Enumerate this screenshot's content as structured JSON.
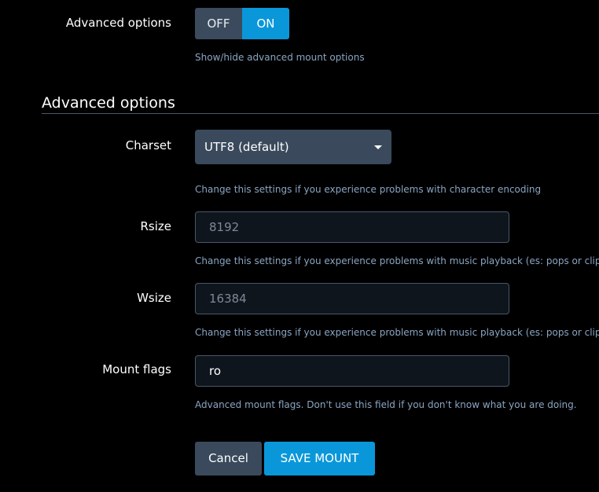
{
  "advanced_toggle": {
    "label": "Advanced options",
    "off_label": "OFF",
    "on_label": "ON",
    "selected": "ON",
    "help": "Show/hide advanced mount options"
  },
  "section": {
    "title": "Advanced options"
  },
  "charset": {
    "label": "Charset",
    "selected": "UTF8 (default)",
    "help": "Change this settings if you experience problems with character encoding"
  },
  "rsize": {
    "label": "Rsize",
    "placeholder": "8192",
    "help": "Change this settings if you experience problems with music playback (es: pops or clips)"
  },
  "wsize": {
    "label": "Wsize",
    "placeholder": "16384",
    "help": "Change this settings if you experience problems with music playback (es: pops or clips)"
  },
  "mount_flags": {
    "label": "Mount flags",
    "value": "ro",
    "help": "Advanced mount flags. Don't use this field if you don't know what you are doing."
  },
  "actions": {
    "cancel_label": "Cancel",
    "save_label": "SAVE MOUNT"
  },
  "colors": {
    "background": "#000000",
    "accent": "#0a97d9",
    "control_bg": "#3a4a5c",
    "help_text": "#8aa5c2"
  }
}
